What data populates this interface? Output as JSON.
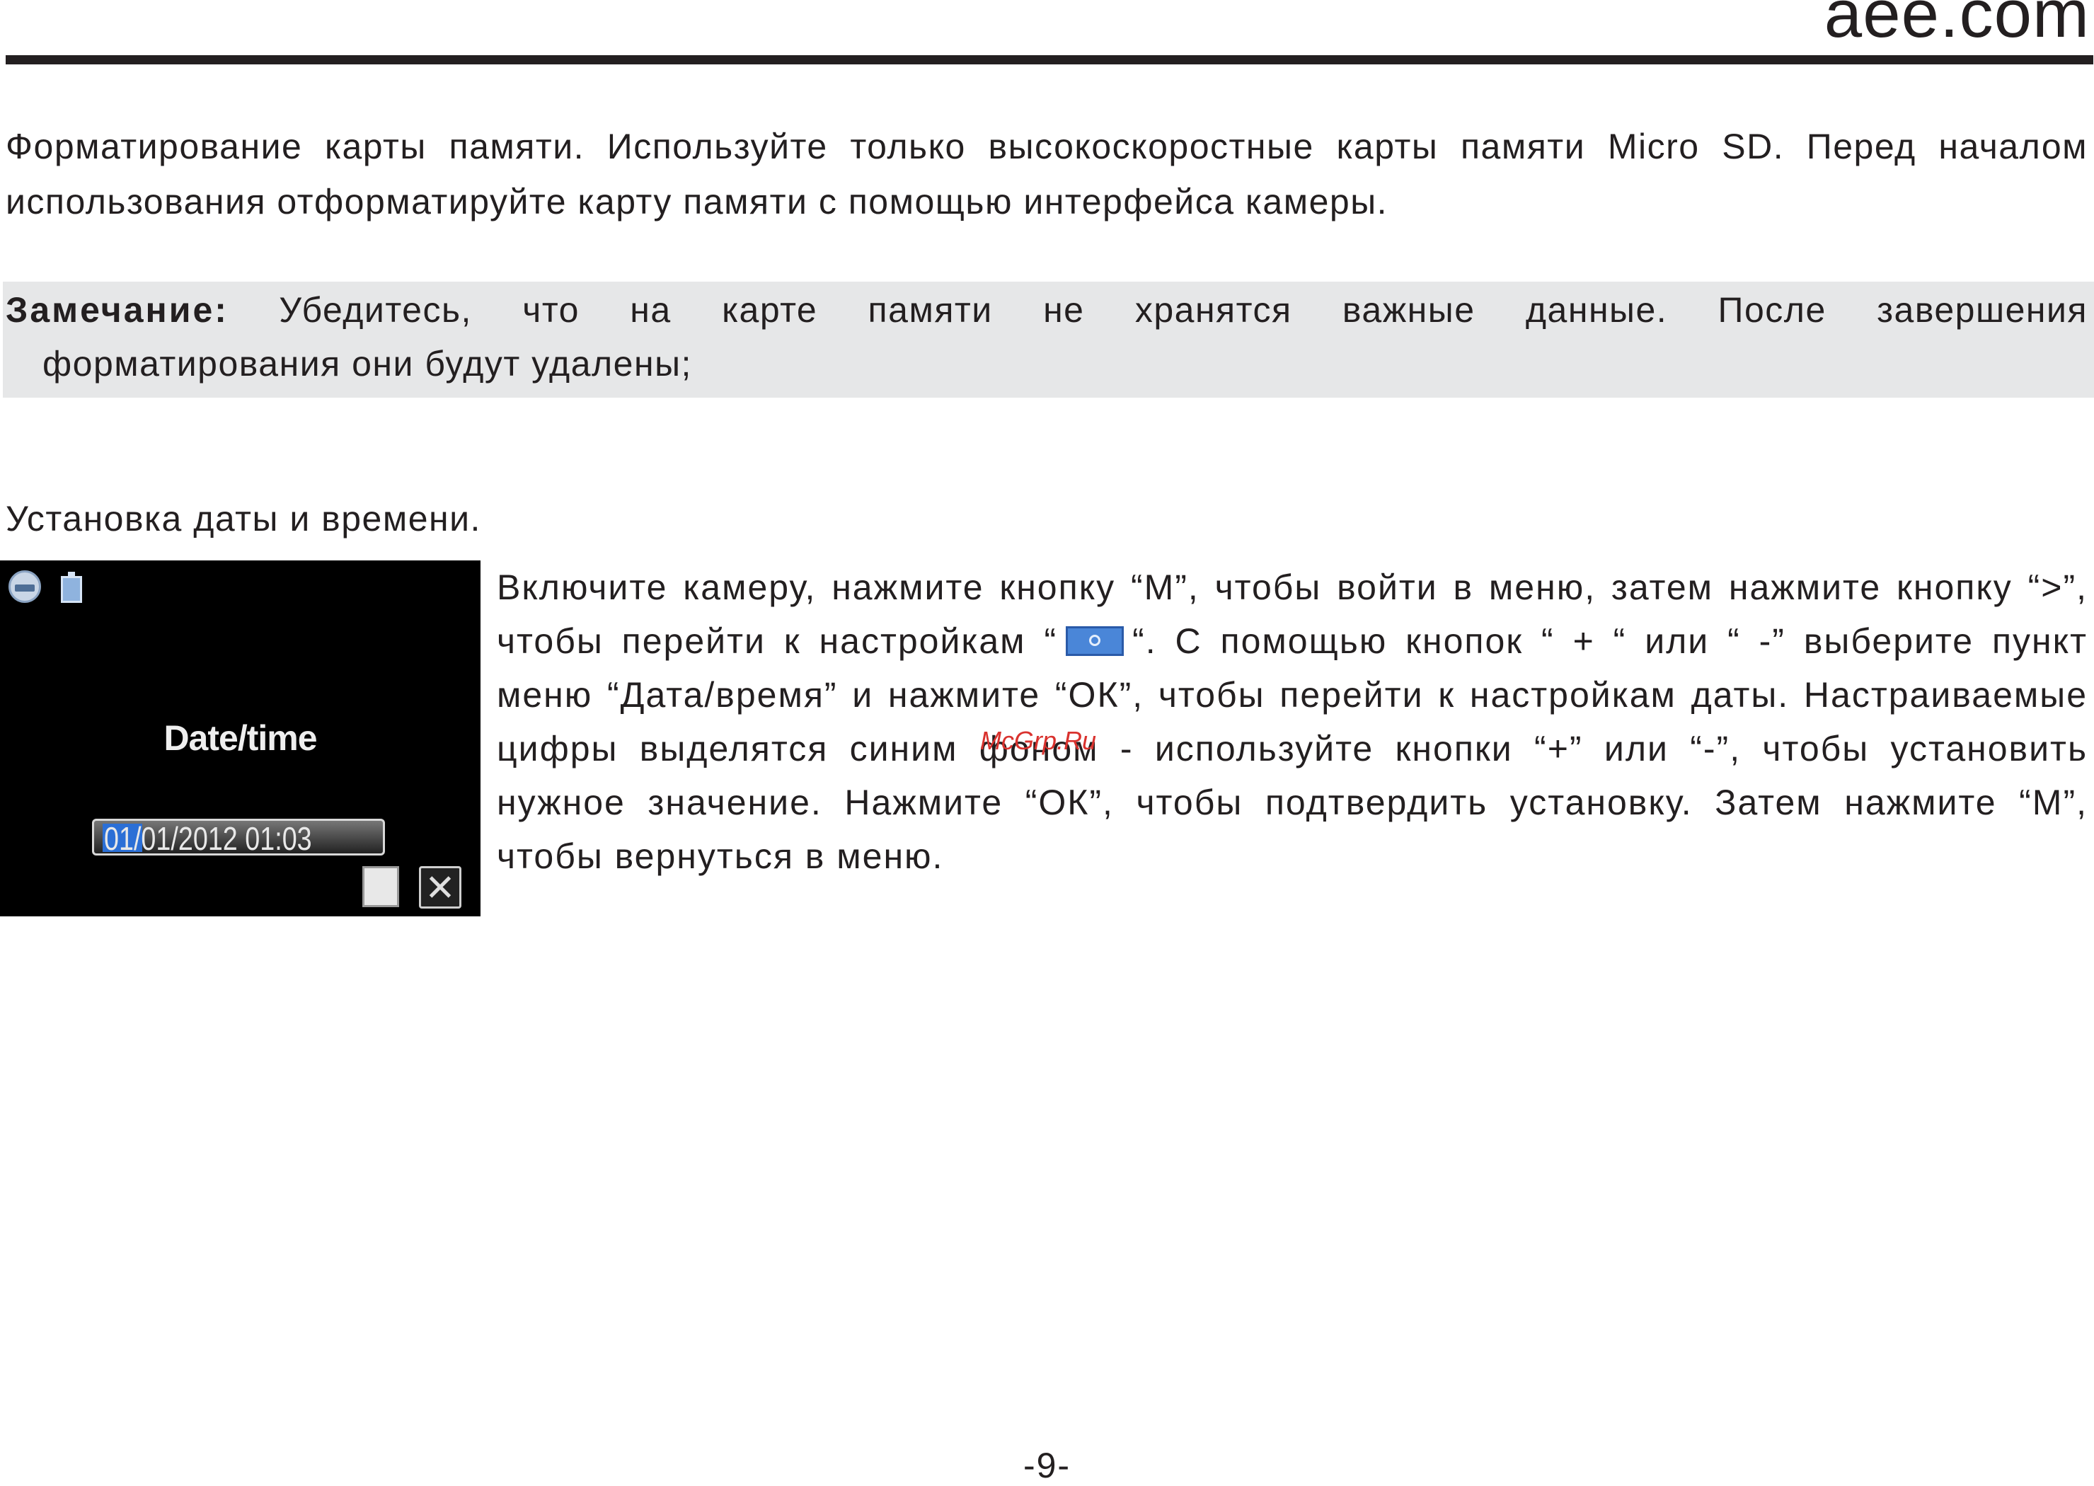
{
  "header": {
    "brand": "aee.com"
  },
  "format_section": {
    "text": "Форматирование карты памяти. Используйте только высокоскоростные карты памяти Micro SD. Перед началом использования отформатируйте карту памяти с помощью интерфейса камеры."
  },
  "note": {
    "label": "Замечание:",
    "line1": "Убедитесь, что на карте памяти не хранятся важные данные. После завершения",
    "line2": "форматирования они будут удалены;"
  },
  "date_section": {
    "heading": "Установка даты и времени.",
    "camera_screen": {
      "title": "Date/time",
      "date_value": "01/01/2012 01:03",
      "highlight_color": "#2b6fd6",
      "icons": [
        "video-mode-icon",
        "battery-icon",
        "save-icon",
        "close-icon"
      ]
    },
    "instructions_part1": "Включите камеру, нажмите кнопку “М”, чтобы войти в меню, затем нажмите кнопку “>”, чтобы перейти к настройкам “",
    "instructions_icon": "settings-icon",
    "instructions_part2": "“. С помощью кнопок “ + “ или “ -” выберите пункт меню “Дата/время” и нажмите “ОК”, чтобы перейти к настройкам даты. Настраиваемые цифры выделятся синим фоном - используйте кнопки “+” или “-”, чтобы установить нужное значение. Нажмите “ОК”, чтобы подтвердить установку. Затем нажмите “М”, чтобы вернуться в меню."
  },
  "watermark": {
    "text": "McGrp.Ru",
    "color": "#d9322e"
  },
  "footer": {
    "page_number": "-9-"
  }
}
